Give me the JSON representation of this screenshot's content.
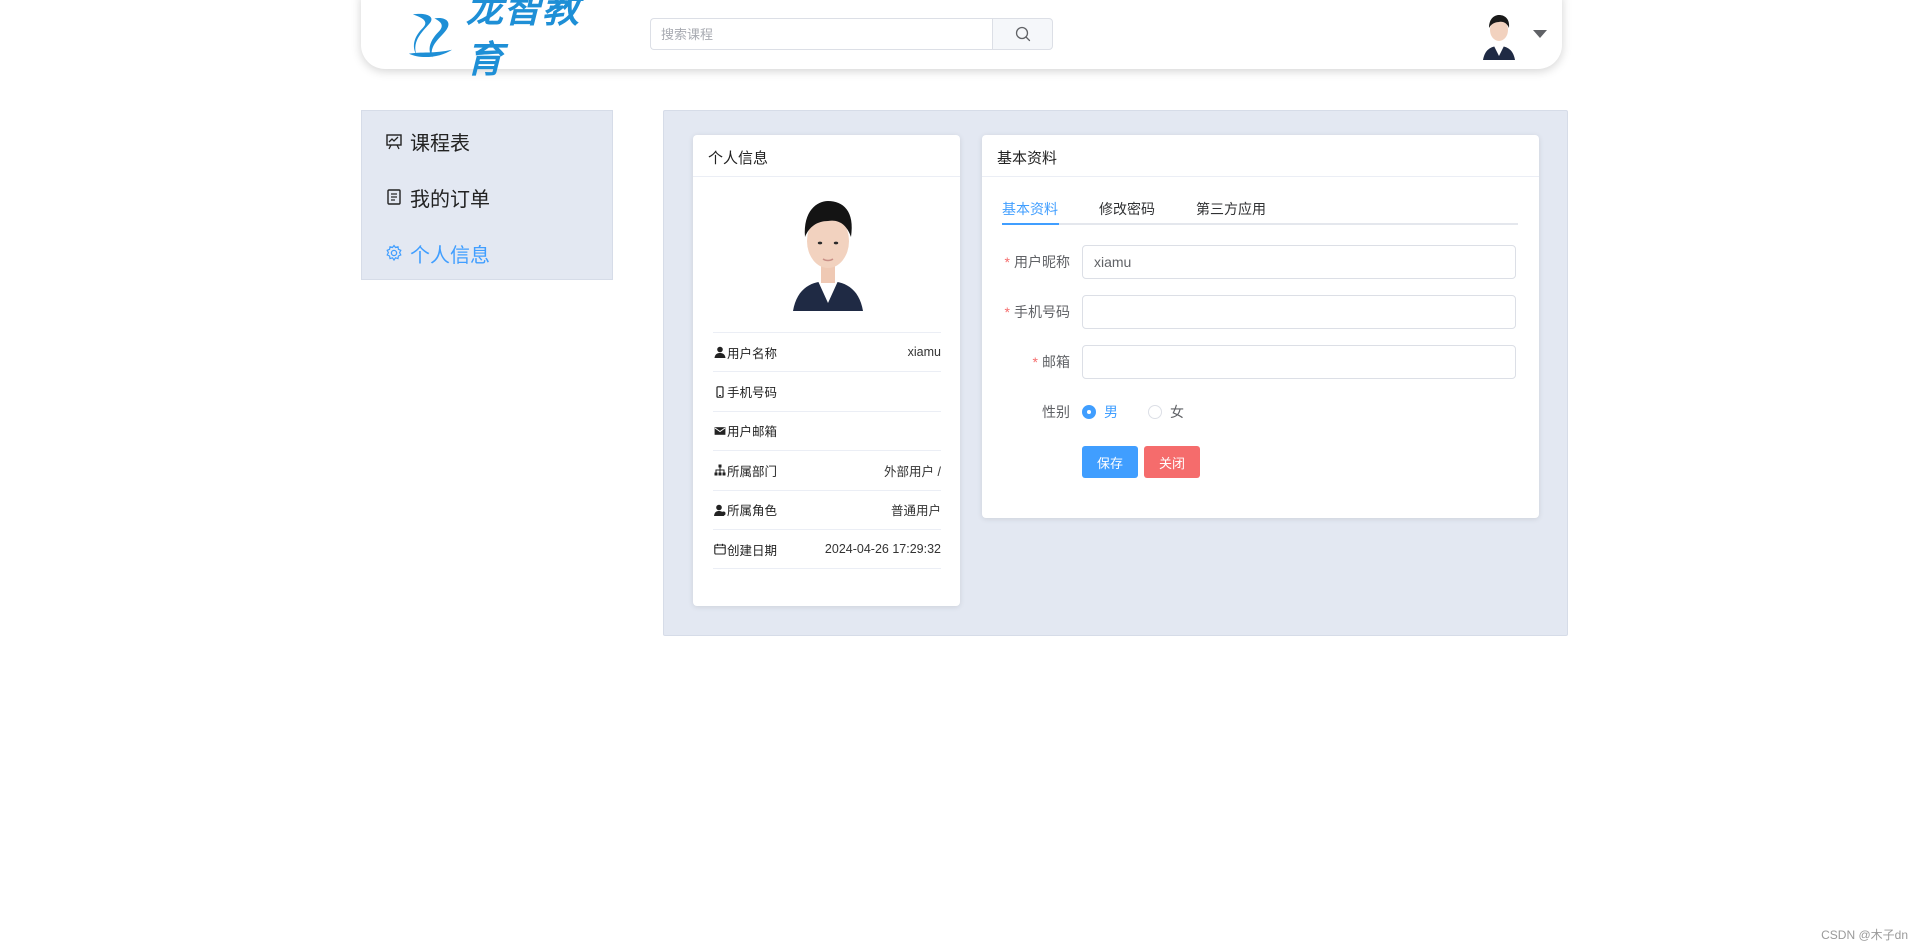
{
  "header": {
    "logo_text": "龙智教育",
    "search_placeholder": "搜索课程",
    "brand_color": "#1e8fd6"
  },
  "sidebar": {
    "items": [
      {
        "label": "课程表",
        "icon": "presentation-chart-icon",
        "active": false
      },
      {
        "label": "我的订单",
        "icon": "document-icon",
        "active": false
      },
      {
        "label": "个人信息",
        "icon": "gear-icon",
        "active": true
      }
    ]
  },
  "profile_card": {
    "title": "个人信息",
    "rows": [
      {
        "icon": "user-icon",
        "label": "用户名称",
        "value": "xiamu"
      },
      {
        "icon": "phone-icon",
        "label": "手机号码",
        "value": ""
      },
      {
        "icon": "mail-icon",
        "label": "用户邮箱",
        "value": ""
      },
      {
        "icon": "org-tree-icon",
        "label": "所属部门",
        "value": "外部用户 /"
      },
      {
        "icon": "role-icon",
        "label": "所属角色",
        "value": "普通用户"
      },
      {
        "icon": "calendar-icon",
        "label": "创建日期",
        "value": "2024-04-26 17:29:32"
      }
    ]
  },
  "basic_card": {
    "title": "基本资料",
    "tabs": [
      {
        "label": "基本资料",
        "active": true
      },
      {
        "label": "修改密码",
        "active": false
      },
      {
        "label": "第三方应用",
        "active": false
      }
    ],
    "form": {
      "nickname_label": "用户昵称",
      "nickname_value": "xiamu",
      "phone_label": "手机号码",
      "phone_value": "",
      "email_label": "邮箱",
      "email_value": "",
      "gender_label": "性别",
      "gender_options": [
        "男",
        "女"
      ],
      "gender_selected": "男",
      "save_label": "保存",
      "close_label": "关闭"
    }
  },
  "watermark": "CSDN @木子dn",
  "colors": {
    "accent": "#409eff",
    "danger": "#f56c6c",
    "panel_bg": "#e3e8f2"
  }
}
